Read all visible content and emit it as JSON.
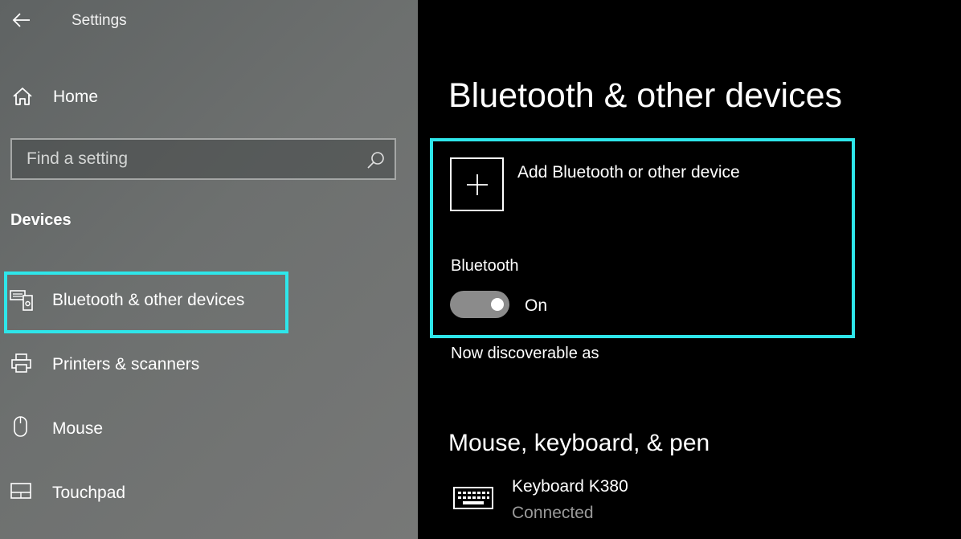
{
  "app": {
    "title": "Settings"
  },
  "sidebar": {
    "home_label": "Home",
    "search_placeholder": "Find a setting",
    "section_title": "Devices",
    "items": [
      {
        "label": "Bluetooth & other devices",
        "icon": "bluetooth-devices-icon",
        "selected": true
      },
      {
        "label": "Printers & scanners",
        "icon": "printer-icon",
        "selected": false
      },
      {
        "label": "Mouse",
        "icon": "mouse-icon",
        "selected": false
      },
      {
        "label": "Touchpad",
        "icon": "touchpad-icon",
        "selected": false
      }
    ]
  },
  "main": {
    "title": "Bluetooth & other devices",
    "add_device_label": "Add Bluetooth or other device",
    "bluetooth_label": "Bluetooth",
    "bluetooth_state": "On",
    "discoverable_text": "Now discoverable as",
    "section_heading": "Mouse, keyboard, & pen",
    "devices": [
      {
        "name": "Keyboard K380",
        "status": "Connected",
        "icon": "keyboard-icon"
      }
    ]
  },
  "colors": {
    "highlight": "#2ee6ea",
    "sidebar_bg": "#6d706f",
    "main_bg": "#000000",
    "toggle_track": "#8b8b8b",
    "muted_text": "#9a9a9a"
  }
}
